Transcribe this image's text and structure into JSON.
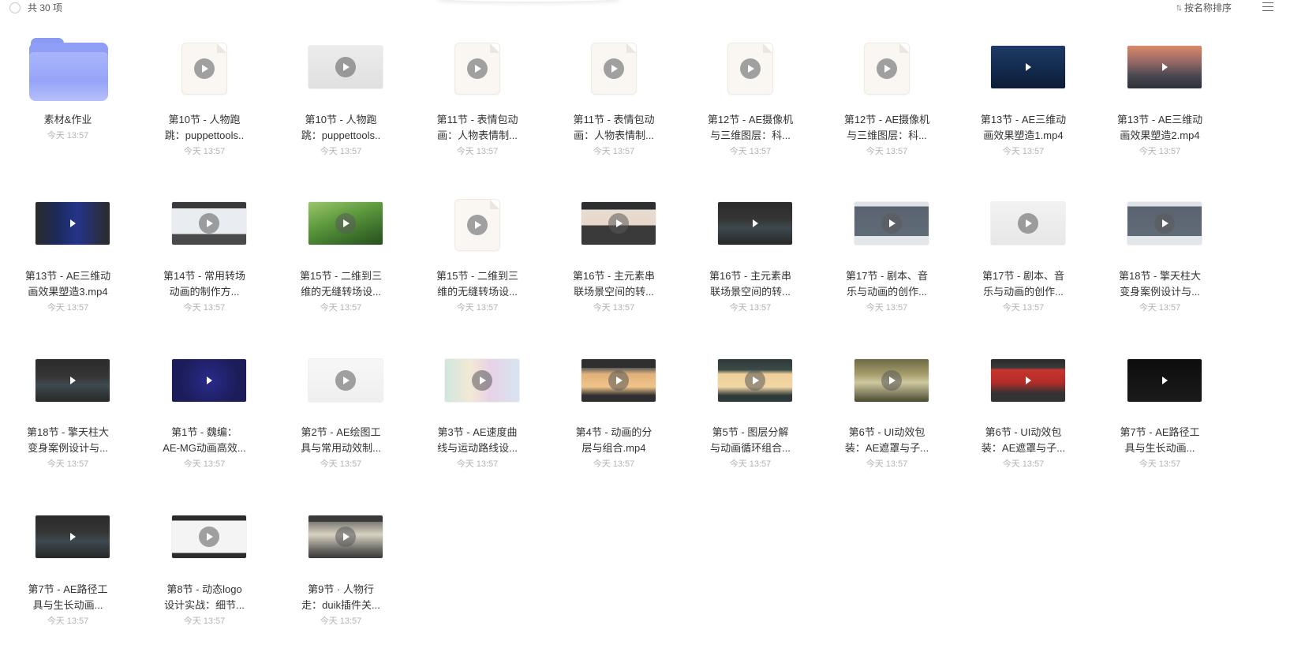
{
  "header": {
    "count_label": "共 30 项",
    "sort_label": "按名称排序",
    "sort_icon": "↑↓"
  },
  "items": [
    {
      "type": "folder",
      "line1": "素材&作业",
      "line2": "",
      "time": "今天 13:57"
    },
    {
      "type": "doc",
      "line1": "第10节 - 人物跑",
      "line2": "跳：puppettools..",
      "time": "今天 13:57"
    },
    {
      "type": "video",
      "style": "gray",
      "line1": "第10节 - 人物跑",
      "line2": "跳：puppettools..",
      "time": "今天 13:57"
    },
    {
      "type": "doc",
      "line1": "第11节 - 表情包动",
      "line2": "画：人物表情制...",
      "time": "今天 13:57"
    },
    {
      "type": "doc",
      "line1": "第11节 - 表情包动",
      "line2": "画：人物表情制...",
      "time": "今天 13:57"
    },
    {
      "type": "doc",
      "line1": "第12节 - AE摄像机",
      "line2": "与三维图层：科...",
      "time": "今天 13:57"
    },
    {
      "type": "doc",
      "line1": "第12节 - AE摄像机",
      "line2": "与三维图层：科...",
      "time": "今天 13:57"
    },
    {
      "type": "video",
      "style": "navy",
      "line1": "第13节 - AE三维动",
      "line2": "画效果塑造1.mp4",
      "time": "今天 13:57"
    },
    {
      "type": "video",
      "style": "mountain",
      "line1": "第13节 - AE三维动",
      "line2": "画效果塑造2.mp4",
      "time": "今天 13:57"
    },
    {
      "type": "video",
      "style": "space",
      "line1": "第13节 - AE三维动",
      "line2": "画效果塑造3.mp4",
      "time": "今天 13:57"
    },
    {
      "type": "video",
      "style": "editor",
      "line1": "第14节 - 常用转场",
      "line2": "动画的制作方...",
      "time": "今天 13:57"
    },
    {
      "type": "video",
      "style": "green",
      "line1": "第15节 - 二维到三",
      "line2": "维的无缝转场设...",
      "time": "今天 13:57"
    },
    {
      "type": "doc",
      "line1": "第15节 - 二维到三",
      "line2": "维的无缝转场设...",
      "time": "今天 13:57"
    },
    {
      "type": "video",
      "style": "panels",
      "line1": "第16节 - 主元素串",
      "line2": "联场景空间的转...",
      "time": "今天 13:57"
    },
    {
      "type": "video",
      "style": "dark",
      "line1": "第16节 - 主元素串",
      "line2": "联场景空间的转...",
      "time": "今天 13:57"
    },
    {
      "type": "video",
      "style": "ps",
      "line1": "第17节 - 剧本、音",
      "line2": "乐与动画的创作...",
      "time": "今天 13:57"
    },
    {
      "type": "video",
      "style": "light",
      "line1": "第17节 - 剧本、音",
      "line2": "乐与动画的创作...",
      "time": "今天 13:57"
    },
    {
      "type": "video",
      "style": "ps",
      "line1": "第18节 - 擎天柱大",
      "line2": "变身案例设计与...",
      "time": "今天 13:57"
    },
    {
      "type": "video",
      "style": "dark",
      "line1": "第18节 - 擎天柱大",
      "line2": "变身案例设计与...",
      "time": "今天 13:57"
    },
    {
      "type": "video",
      "style": "mg",
      "line1": "第1节 - 魏编：",
      "line2": "AE-MG动画高效...",
      "time": "今天 13:57"
    },
    {
      "type": "video",
      "style": "white",
      "line1": "第2节 - AE绘图工",
      "line2": "具与常用动效制...",
      "time": "今天 13:57"
    },
    {
      "type": "video",
      "style": "colorful",
      "line1": "第3节 - AE速度曲",
      "line2": "线与运动路线设...",
      "time": "今天 13:57"
    },
    {
      "type": "video",
      "style": "orangewin",
      "line1": "第4节 - 动画的分",
      "line2": "层与组合.mp4",
      "time": "今天 13:57"
    },
    {
      "type": "video",
      "style": "orangewin2",
      "line1": "第5节 - 图层分解",
      "line2": "与动画循环组合...",
      "time": "今天 13:57"
    },
    {
      "type": "video",
      "style": "olive",
      "line1": "第6节 - UI动效包",
      "line2": "装：AE遮罩与子...",
      "time": "今天 13:57"
    },
    {
      "type": "video",
      "style": "red",
      "line1": "第6节 - UI动效包",
      "line2": "装：AE遮罩与子...",
      "time": "今天 13:57"
    },
    {
      "type": "video",
      "style": "black",
      "line1": "第7节 - AE路径工",
      "line2": "具与生长动画...",
      "time": "今天 13:57"
    },
    {
      "type": "video",
      "style": "dark",
      "line1": "第7节 - AE路径工",
      "line2": "具与生长动画...",
      "time": "今天 13:57"
    },
    {
      "type": "video",
      "style": "logo",
      "line1": "第8节 - 动态logo",
      "line2": "设计实战：细节...",
      "time": "今天 13:57"
    },
    {
      "type": "video",
      "style": "duik",
      "line1": "第9节 · 人物行",
      "line2": "走：duik插件关...",
      "time": "今天 13:57"
    }
  ]
}
